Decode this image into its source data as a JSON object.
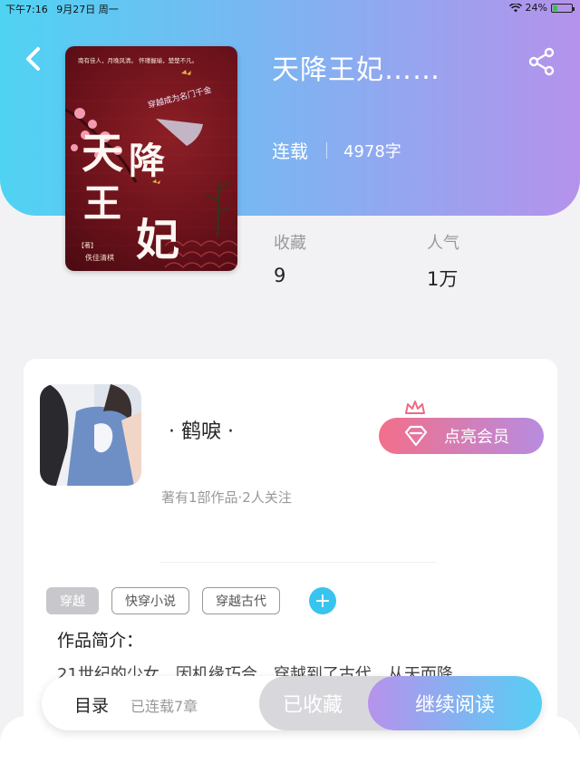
{
  "status_bar": {
    "time": "下午7:16",
    "date": "9月27日 周一",
    "battery": "24%",
    "battery_level": 0.24
  },
  "book": {
    "title": "天降王妃……",
    "status": "连载",
    "word_count": "4978字",
    "cover": {
      "title_chars": [
        "天",
        "降",
        "王",
        "妃"
      ],
      "top_text": "南有佳人，月晚风清。  怀瑾握瑜，楚楚不凡。",
      "author_tag": "【著】",
      "author_name": "佚佳清棋",
      "script_text": "穿越成为名门千金"
    }
  },
  "stats": [
    {
      "label": "收藏",
      "value": "9"
    },
    {
      "label": "人气",
      "value": "1万"
    }
  ],
  "author": {
    "name": "· 鹤唳 ·",
    "meta": "著有1部作品·2人关注",
    "vip_label": "点亮会员"
  },
  "tags": [
    {
      "label": "穿越",
      "active": true
    },
    {
      "label": "快穿小说",
      "active": false
    },
    {
      "label": "穿越古代",
      "active": false
    }
  ],
  "add_tag_symbol": "+",
  "intro": {
    "title": "作品简介：",
    "text": "21世纪的少女，因机缘巧合，穿越到了古代，从天而降"
  },
  "bottom_bar": {
    "catalog_label": "目录",
    "catalog_count": "已连载7章",
    "collected_label": "已收藏",
    "read_label": "继续阅读"
  },
  "colors": {
    "header_start": "#4fd3f3",
    "header_end": "#b592ec",
    "vip_start": "#f26f8a",
    "accent_blue": "#38c4ef"
  }
}
